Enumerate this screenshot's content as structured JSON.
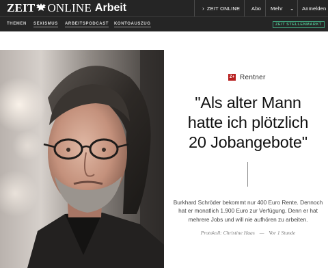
{
  "brand": {
    "zeit": "ZEIT",
    "online": "ONLINE",
    "section": "Arbeit"
  },
  "top_nav": {
    "zeit_online": "ZEIT ONLINE",
    "abo": "Abo",
    "mehr": "Mehr",
    "anmelden": "Anmelden"
  },
  "sub_nav": {
    "items": [
      "THEMEN",
      "SEXISMUS",
      "ARBEITSPODCAST",
      "KONTOAUSZUG"
    ],
    "stellenmarkt": "ZEIT STELLENMARKT"
  },
  "article": {
    "badge": "Z+",
    "kicker": "Rentner",
    "headline_lines": [
      "\"Als alter Mann",
      "hatte ich plötzlich",
      "20 Jobangebote\""
    ],
    "summary_lines": [
      "Burkhard Schröder bekommt nur 400 Euro Rente. Dennoch",
      "hat er monatlich 1.900 Euro zur Verfügung. Denn er hat",
      "mehrere Jobs und will nie aufhören zu arbeiten."
    ],
    "byline": {
      "author": "Protokoll: Christine Haas",
      "separator": "—",
      "time": "Vor 1 Stunde"
    }
  },
  "icons": {
    "crest": "eagle-crest-icon",
    "arrow": "chevron-right-icon",
    "dropdown": "chevron-down-icon"
  },
  "colors": {
    "bar": "#252525",
    "badge_red": "#b81f1f",
    "stellenmarkt_green": "#4fbf8f"
  }
}
